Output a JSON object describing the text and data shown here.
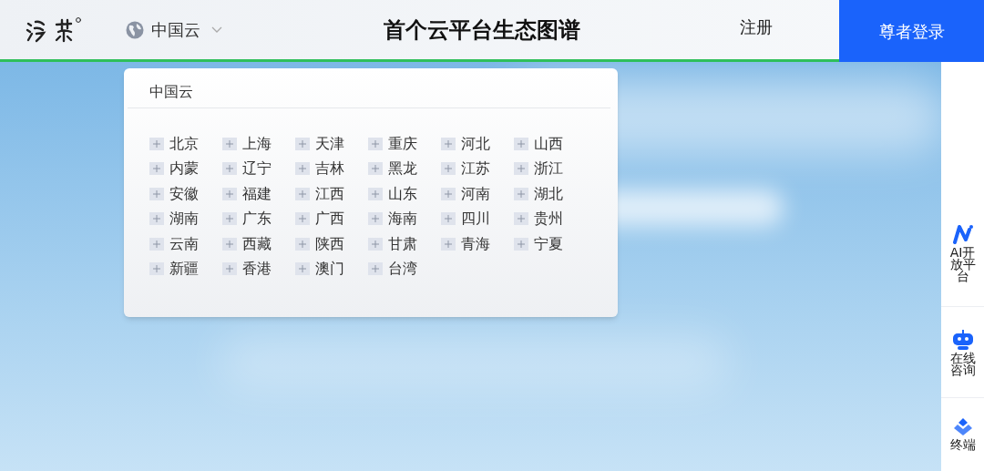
{
  "header": {
    "region_selector": {
      "label": "中国云"
    },
    "title": "首个云平台生态图谱",
    "register": "注册",
    "login": "尊者登录"
  },
  "region_dropdown": {
    "title": "中国云",
    "regions": [
      "北京",
      "上海",
      "天津",
      "重庆",
      "河北",
      "山西",
      "内蒙",
      "辽宁",
      "吉林",
      "黑龙",
      "江苏",
      "浙江",
      "安徽",
      "福建",
      "江西",
      "山东",
      "河南",
      "湖北",
      "湖南",
      "广东",
      "广西",
      "海南",
      "四川",
      "贵州",
      "云南",
      "西藏",
      "陕西",
      "甘肃",
      "青海",
      "宁夏",
      "新疆",
      "香港",
      "澳门",
      "台湾"
    ]
  },
  "side_bar": {
    "items": [
      {
        "label": "AI开放平台"
      },
      {
        "label": "在线咨询"
      },
      {
        "label": "终端"
      }
    ]
  }
}
